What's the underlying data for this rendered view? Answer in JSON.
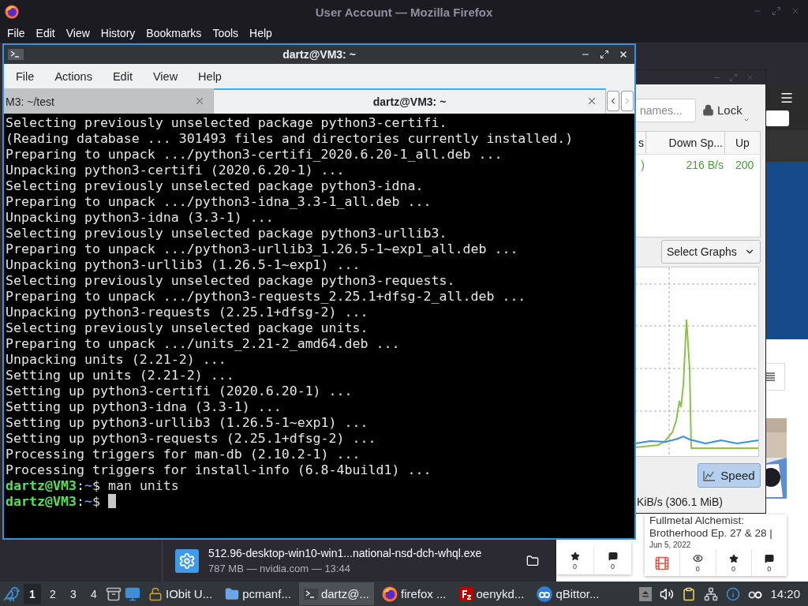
{
  "firefox": {
    "title": "User Account — Mozilla Firefox",
    "menu": [
      "File",
      "Edit",
      "View",
      "History",
      "Bookmarks",
      "Tools",
      "Help"
    ]
  },
  "terminal": {
    "title": "dartz@VM3: ~",
    "menu": [
      "File",
      "Actions",
      "Edit",
      "View",
      "Help"
    ],
    "tabs": [
      {
        "label": "M3: ~/test",
        "selected": false
      },
      {
        "label": "dartz@VM3: ~",
        "selected": true
      }
    ],
    "lines": [
      {
        "kind": "output",
        "text": "Selecting previously unselected package python3-certifi."
      },
      {
        "kind": "output",
        "text": "(Reading database ... 301493 files and directories currently installed.)"
      },
      {
        "kind": "output",
        "text": "Preparing to unpack .../python3-certifi_2020.6.20-1_all.deb ..."
      },
      {
        "kind": "output",
        "text": "Unpacking python3-certifi (2020.6.20-1) ..."
      },
      {
        "kind": "output",
        "text": "Selecting previously unselected package python3-idna."
      },
      {
        "kind": "output",
        "text": "Preparing to unpack .../python3-idna_3.3-1_all.deb ..."
      },
      {
        "kind": "output",
        "text": "Unpacking python3-idna (3.3-1) ..."
      },
      {
        "kind": "output",
        "text": "Selecting previously unselected package python3-urllib3."
      },
      {
        "kind": "output",
        "text": "Preparing to unpack .../python3-urllib3_1.26.5-1~exp1_all.deb ..."
      },
      {
        "kind": "output",
        "text": "Unpacking python3-urllib3 (1.26.5-1~exp1) ..."
      },
      {
        "kind": "output",
        "text": "Selecting previously unselected package python3-requests."
      },
      {
        "kind": "output",
        "text": "Preparing to unpack .../python3-requests_2.25.1+dfsg-2_all.deb ..."
      },
      {
        "kind": "output",
        "text": "Unpacking python3-requests (2.25.1+dfsg-2) ..."
      },
      {
        "kind": "output",
        "text": "Selecting previously unselected package units."
      },
      {
        "kind": "output",
        "text": "Preparing to unpack .../units_2.21-2_amd64.deb ..."
      },
      {
        "kind": "output",
        "text": "Unpacking units (2.21-2) ..."
      },
      {
        "kind": "output",
        "text": "Setting up units (2.21-2) ..."
      },
      {
        "kind": "output",
        "text": "Setting up python3-certifi (2020.6.20-1) ..."
      },
      {
        "kind": "output",
        "text": "Setting up python3-idna (3.3-1) ..."
      },
      {
        "kind": "output",
        "text": "Setting up python3-urllib3 (1.26.5-1~exp1) ..."
      },
      {
        "kind": "output",
        "text": "Setting up python3-requests (2.25.1+dfsg-2) ..."
      },
      {
        "kind": "output",
        "text": "Processing triggers for man-db (2.10.2-1) ..."
      },
      {
        "kind": "output",
        "text": "Processing triggers for install-info (6.8-4build1) ..."
      },
      {
        "kind": "prompt",
        "user": "dartz@VM3",
        "sep": ":",
        "path": "~",
        "symbol": "$",
        "command": "man units",
        "cursor": false
      },
      {
        "kind": "prompt",
        "user": "dartz@VM3",
        "sep": ":",
        "path": "~",
        "symbol": "$",
        "cursor": true
      }
    ]
  },
  "qbittorrent": {
    "search": {
      "placeholder": "names..."
    },
    "lock": "Lock",
    "columns": [
      "s",
      "Down Sp...",
      "Up"
    ],
    "row": [
      ")",
      "216 B/s",
      "200"
    ],
    "select": "Select Graphs",
    "speed": {
      "label": "Speed",
      "pressed": true
    },
    "status": "KiB/s (306.1 MiB)"
  },
  "webpage": {
    "cards": [
      {
        "stats": [
          {
            "kind": "star",
            "count": "0"
          },
          {
            "kind": "comment",
            "count": "0"
          }
        ]
      },
      {
        "kind": "picture",
        "title": "Fullmetal Alchemist: Brotherhood Ep. 27 & 28 |",
        "date": "Jun 5, 2022",
        "stats": [
          {
            "kind": "film"
          },
          {
            "kind": "views",
            "count": "0"
          },
          {
            "kind": "star",
            "count": "0"
          },
          {
            "kind": "comment",
            "count": "0"
          }
        ]
      }
    ]
  },
  "download": {
    "file": "512.96-desktop-win10-win1...national-nsd-dch-whql.exe",
    "details": "787 MB — nvidia.com — 13:44"
  },
  "taskbar": {
    "workspaces": [
      {
        "label": "1",
        "selected": true
      },
      {
        "label": "2",
        "selected": false
      },
      {
        "label": "3",
        "selected": false
      },
      {
        "label": "4",
        "selected": false
      }
    ],
    "tasks": [
      {
        "kind": "unlock",
        "label": "IObit U...",
        "active": false
      },
      {
        "kind": "folder",
        "label": "pcmanf...",
        "active": false
      },
      {
        "kind": "terminal",
        "label": "dartz@...",
        "active": true
      },
      {
        "kind": "firefox",
        "label": "firefox ...",
        "active": false
      },
      {
        "kind": "filezilla",
        "label": "oenykd...",
        "active": false
      },
      {
        "kind": "qbittorrent",
        "label": "qBittor...",
        "active": false
      }
    ],
    "clock": "14:20"
  }
}
